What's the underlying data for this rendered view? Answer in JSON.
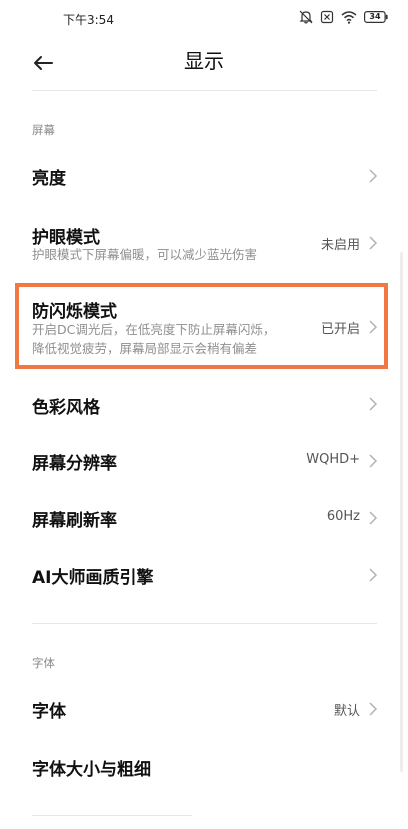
{
  "status_bar": {
    "time": "下午3:54",
    "battery": "34",
    "icons": [
      "mute-icon",
      "sim-off-icon",
      "wifi-icon",
      "battery-icon"
    ]
  },
  "header": {
    "title": "显示",
    "back_icon": "arrow-left-icon"
  },
  "sections": [
    {
      "label": "屏幕",
      "items": [
        {
          "label": "亮度",
          "value": "",
          "sub": []
        },
        {
          "label": "护眼模式",
          "value": "未启用",
          "sub": [
            "护眼模式下屏幕偏暖，可以减少蓝光伤害"
          ]
        },
        {
          "label": "防闪烁模式",
          "value": "已开启",
          "sub": [
            "开启DC调光后，在低亮度下防止屏幕闪烁，",
            "降低视觉疲劳，屏幕局部显示会稍有偏差"
          ]
        },
        {
          "label": "色彩风格",
          "value": "",
          "sub": []
        },
        {
          "label": "屏幕分辨率",
          "value": "WQHD+",
          "sub": []
        },
        {
          "label": "屏幕刷新率",
          "value": "60Hz",
          "sub": []
        },
        {
          "label": "AI大师画质引擎",
          "value": "",
          "sub": []
        }
      ]
    },
    {
      "label": "字体",
      "items": [
        {
          "label": "字体",
          "value": "默认",
          "sub": []
        },
        {
          "label": "字体大小与粗细",
          "value": "",
          "sub": []
        }
      ]
    }
  ],
  "colors": {
    "highlight": "#f07845",
    "secondary_text": "#8f8f8f",
    "section_label": "#8a8a8a"
  }
}
